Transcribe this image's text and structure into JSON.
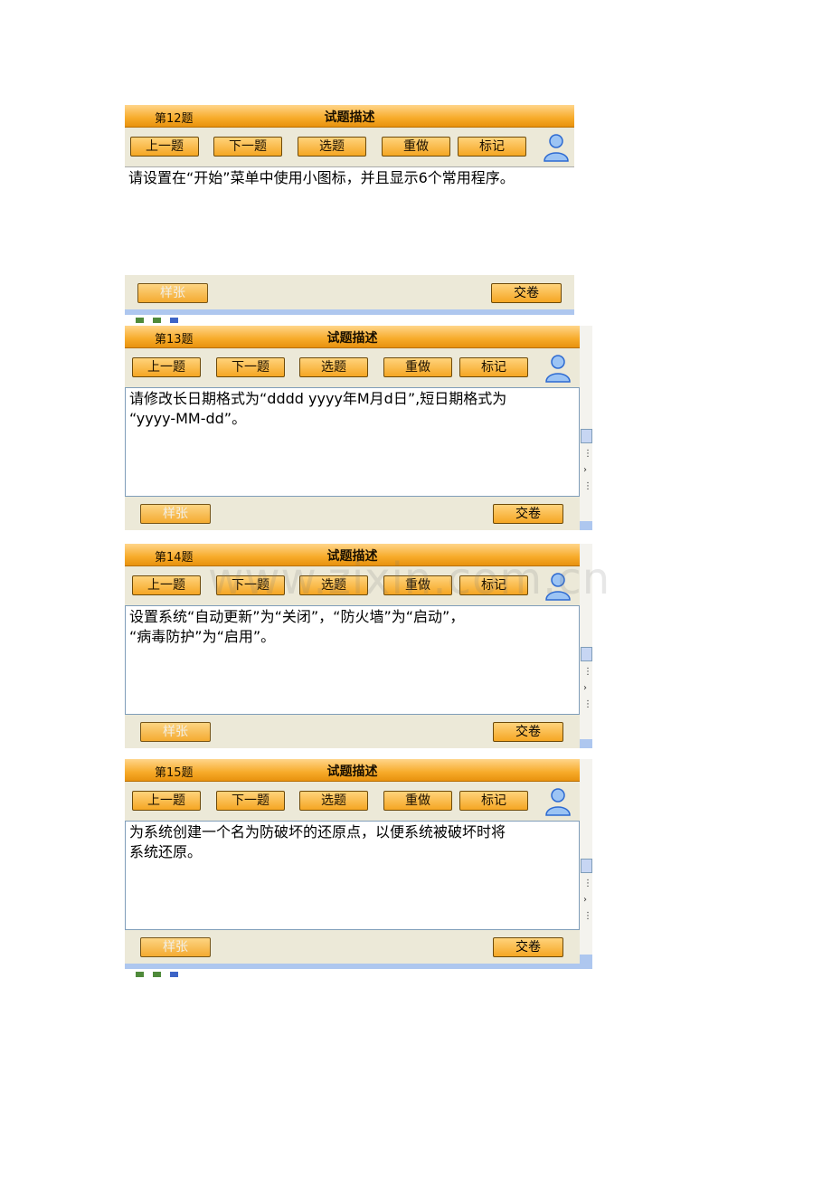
{
  "panels": [
    {
      "number_label": "第12题",
      "title": "试题描述",
      "buttons": {
        "prev": "上一题",
        "next": "下一题",
        "select": "选题",
        "redo": "重做",
        "mark": "标记"
      },
      "question_lines": [
        "请设置在“开始”菜单中使用小图标，并且显示6个常用程序。"
      ],
      "footer": {
        "sample": "样张",
        "submit": "交卷"
      }
    },
    {
      "number_label": "第13题",
      "title": "试题描述",
      "buttons": {
        "prev": "上一题",
        "next": "下一题",
        "select": "选题",
        "redo": "重做",
        "mark": "标记"
      },
      "question_lines": [
        "请修改长日期格式为“dddd yyyy年M月d日”,短日期格式为",
        "“yyyy-MM-dd”。"
      ],
      "footer": {
        "sample": "样张",
        "submit": "交卷"
      }
    },
    {
      "number_label": "第14题",
      "title": "试题描述",
      "buttons": {
        "prev": "上一题",
        "next": "下一题",
        "select": "选题",
        "redo": "重做",
        "mark": "标记"
      },
      "question_lines": [
        "设置系统“自动更新”为“关闭”，“防火墙”为“启动”，",
        "“病毒防护”为“启用”。"
      ],
      "footer": {
        "sample": "样张",
        "submit": "交卷"
      }
    },
    {
      "number_label": "第15题",
      "title": "试题描述",
      "buttons": {
        "prev": "上一题",
        "next": "下一题",
        "select": "选题",
        "redo": "重做",
        "mark": "标记"
      },
      "question_lines": [
        "为系统创建一个名为防破坏的还原点，以便系统被破坏时将",
        "系统还原。"
      ],
      "footer": {
        "sample": "样张",
        "submit": "交卷"
      }
    }
  ],
  "watermark": "www.zixin.com.cn",
  "colors": {
    "title_gradient_mid": "#f7ab2a",
    "button_gradient_bottom": "#f5a623",
    "panel_bg": "#ece9d8",
    "border_blue": "#7f9db9"
  }
}
